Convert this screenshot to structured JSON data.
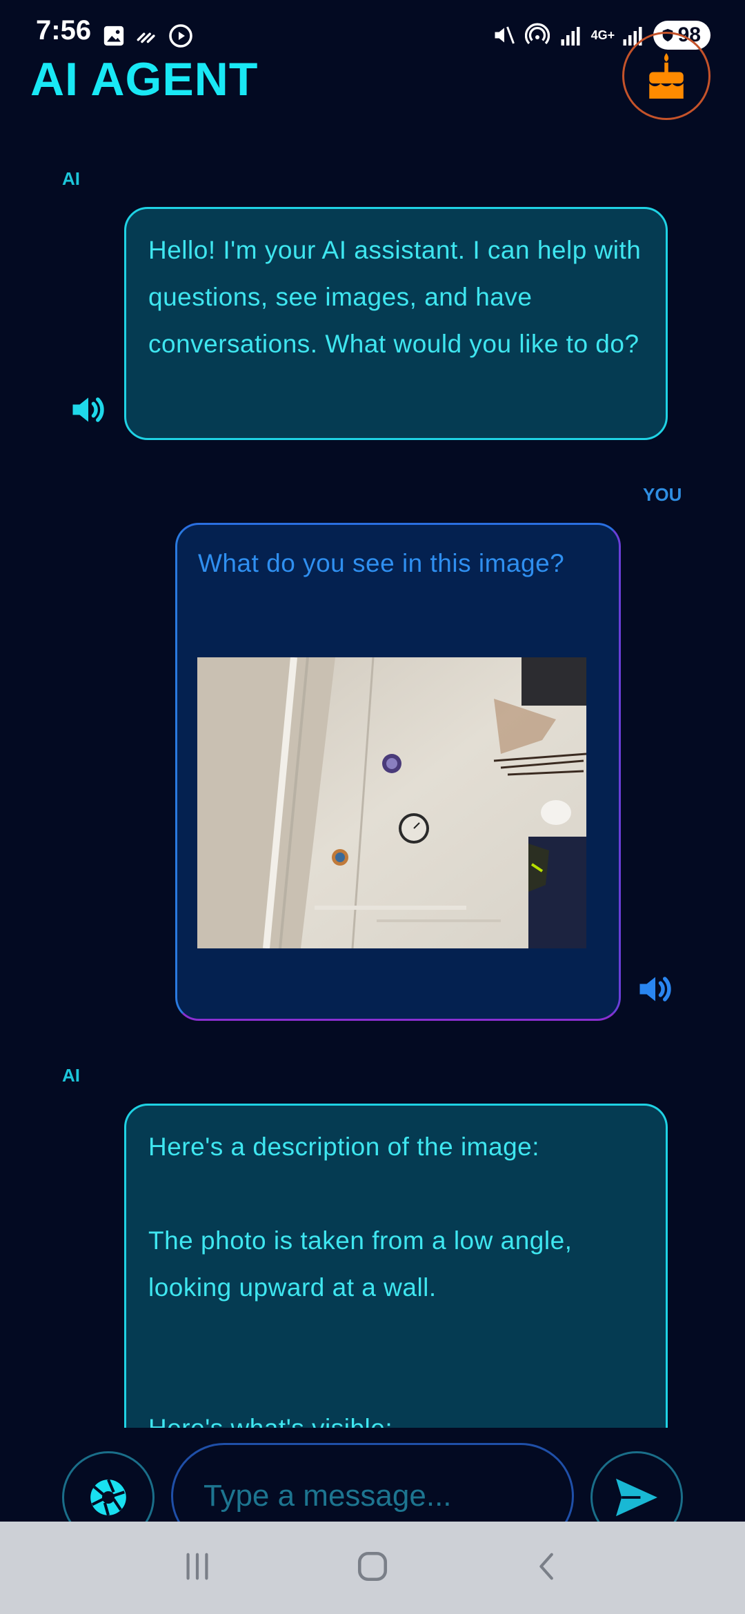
{
  "status_bar": {
    "time": "7:56",
    "battery": "98",
    "network_label": "4G+"
  },
  "header": {
    "title": "AI AGENT",
    "icon": "cake-icon"
  },
  "messages": [
    {
      "sender": "AI",
      "text": "Hello! I'm your AI assistant. I can help with questions, see images, and have conversations. What would you like to do?"
    },
    {
      "sender": "YOU",
      "text": "What do you see in this image?",
      "has_image": true
    },
    {
      "sender": "AI",
      "line1": "Here's a description of the image:",
      "line2": "The photo is taken from a low angle, looking upward at a wall.",
      "line3": "Here's what's visible:"
    }
  ],
  "input": {
    "placeholder": "Type a message..."
  },
  "colors": {
    "background": "#030a22",
    "accent_cyan": "#19e8f5",
    "accent_blue": "#2f8ff0",
    "cake_orange": "#ff8a00"
  }
}
